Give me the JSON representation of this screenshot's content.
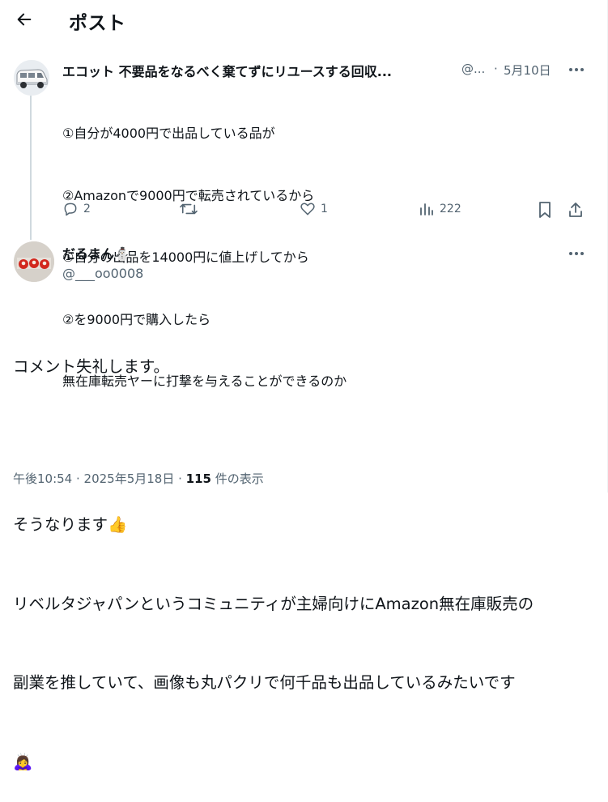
{
  "header": {
    "title": "ポスト"
  },
  "parent_tweet": {
    "author_name": "エコット 不要品をなるべく棄てずにリユースする回収...",
    "handle": "@...",
    "separator": "·",
    "date": "5月10日",
    "lines": [
      "①自分が4000円で出品している品が",
      "②Amazonで9000円で転売されているから",
      "①自分の出品を14000円に値上げしてから",
      "②を9000円で購入したら",
      "無在庫転売ヤーに打撃を与えることができるのか"
    ],
    "stats": {
      "replies": "2",
      "likes": "1",
      "views": "222"
    }
  },
  "reply_tweet": {
    "author_name": "だるまん⛄",
    "handle": "@___oo0008",
    "lines": [
      "コメント失礼します。",
      "",
      "そうなります👍",
      "リベルタジャパンというコミュニティが主婦向けにAmazon無在庫販売の",
      "副業を推していて、画像も丸パクリで何千品も出品しているみたいです",
      "🙇‍♀️"
    ],
    "timestamp": "午後10:54 · 2025年5月18日 · ",
    "view_count": "115",
    "view_label": " 件の表示"
  },
  "colors": {
    "text": "#0f1419",
    "secondary": "#536471",
    "thread_line": "#cfd9de"
  }
}
